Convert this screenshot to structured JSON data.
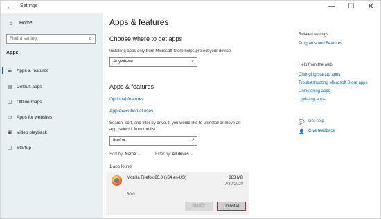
{
  "window": {
    "title": "Settings",
    "back_glyph": "←",
    "controls": {
      "minimize": "—",
      "maximize": "☐",
      "close": "✕"
    }
  },
  "sidebar": {
    "home_label": "Home",
    "search_placeholder": "Find a setting",
    "section": "Apps",
    "items": [
      {
        "label": "Apps & features",
        "icon": "apps-features-icon",
        "glyph": "☰",
        "active": true
      },
      {
        "label": "Default apps",
        "icon": "default-apps-icon",
        "glyph": "▤",
        "active": false
      },
      {
        "label": "Offline maps",
        "icon": "map-icon",
        "glyph": "◫",
        "active": false
      },
      {
        "label": "Apps for websites",
        "icon": "apps-websites-icon",
        "glyph": "▭",
        "active": false
      },
      {
        "label": "Video playback",
        "icon": "video-icon",
        "glyph": "▣",
        "active": false
      },
      {
        "label": "Startup",
        "icon": "startup-icon",
        "glyph": "▢",
        "active": false
      }
    ]
  },
  "main": {
    "title": "Apps & features",
    "where_heading": "Choose where to get apps",
    "where_desc": "Installing apps only from Microsoft Store helps protect your device.",
    "where_value": "Anywhere",
    "features_heading": "Apps & features",
    "optional_features": "Optional features",
    "execution_aliases": "App execution aliases",
    "search_desc_1": "Search, sort, and filter by drive. If you would like to uninstall or move an",
    "search_desc_2": "app, select it from the list.",
    "search_value": "firefox",
    "sort_label": "Sort by:",
    "sort_value": "Name",
    "filter_label": "Filter by:",
    "filter_value": "All drives",
    "found_text": "1 app found",
    "app": {
      "name": "Mozilla Firefox 80.0 (x64 en-US)",
      "size": "383 MB",
      "date": "7/30/2020",
      "version": "80.0",
      "modify_label": "Modify",
      "uninstall_label": "Uninstall"
    }
  },
  "side": {
    "related_title": "Related settings",
    "programs_features": "Programs and Features",
    "help_title": "Help from the web",
    "help_links": [
      "Changing startup apps",
      "Troubleshooting Microsoft Store apps",
      "Uninstalling apps",
      "Updating apps"
    ],
    "get_help": "Get help",
    "give_feedback": "Give feedback"
  },
  "colors": {
    "accent": "#0067b8",
    "sidebar_bg": "#e9f0f4",
    "highlight": "#c1272d"
  }
}
